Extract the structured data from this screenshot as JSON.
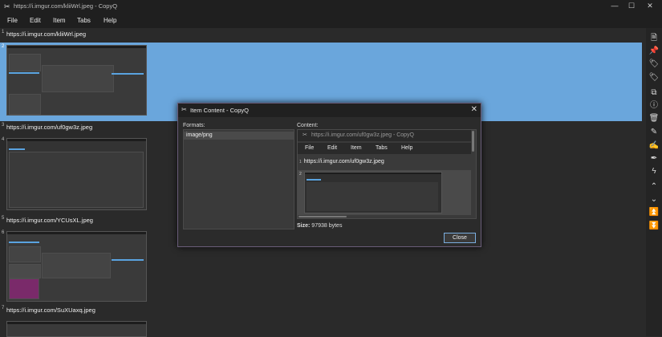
{
  "window": {
    "title": "https://i.imgur.com/kliiWrl.jpeg - CopyQ",
    "app_icon": "copyq-icon",
    "controls": {
      "minimize": "—",
      "maximize": "☐",
      "close": "✕"
    }
  },
  "menu": [
    "File",
    "Edit",
    "Item",
    "Tabs",
    "Help"
  ],
  "items": [
    {
      "number": "1",
      "text": "https://i.imgur.com/kliiWrl.jpeg"
    },
    {
      "number": "2",
      "text": ""
    },
    {
      "number": "3",
      "text": "https://i.imgur.com/uf0gw3z.jpeg"
    },
    {
      "number": "4",
      "text": ""
    },
    {
      "number": "5",
      "text": "https://i.imgur.com/YCUsXL.jpeg"
    },
    {
      "number": "6",
      "text": ""
    },
    {
      "number": "7",
      "text": "https://i.imgur.com/SuXUaxq.jpeg"
    }
  ],
  "toolbar": [
    "new-item-icon",
    "pin-icon",
    "tag-icon",
    "tag-icon",
    "copy-icon",
    "info-icon",
    "delete-icon",
    "edit-icon",
    "edit-notes-icon",
    "pen-icon",
    "lightning-icon",
    "move-up-icon",
    "move-down-icon",
    "move-top-icon",
    "move-bottom-icon"
  ],
  "dialog": {
    "title": "Item Content - CopyQ",
    "formats_label": "Formats:",
    "formats": [
      "image/png"
    ],
    "content_label": "Content:",
    "content_preview": {
      "title": "https://i.imgur.com/uf0gw3z.jpeg - CopyQ",
      "menu": [
        "File",
        "Edit",
        "Item",
        "Tabs",
        "Help"
      ],
      "row1_number": "1",
      "row1_text": "https://i.imgur.com/uf0gw3z.jpeg",
      "row2_number": "2"
    },
    "size_label": "Size:",
    "size_value": "97938 bytes",
    "close_label": "Close",
    "close_icon": "✕"
  },
  "colors": {
    "selection": "#6aa6dc",
    "accent": "#5aa3e0",
    "dialog_border": "#6a5d7a"
  }
}
